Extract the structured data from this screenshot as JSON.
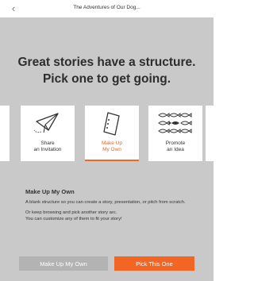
{
  "topbar": {
    "back_icon": "chevron-left-icon",
    "document_title": "The Adventures of Our Dog..."
  },
  "headline": {
    "line1": "Great stories have a structure.",
    "line2": "Pick one to get going."
  },
  "story_types": [
    {
      "icon": "paper-plane-icon",
      "label_line1": "Share",
      "label_line2": "an Invitation"
    },
    {
      "icon": "blank-page-icon",
      "label_line1": "Make Up",
      "label_line2": "My Own",
      "selected": true
    },
    {
      "icon": "fish-school-icon",
      "label_line1": "Promote",
      "label_line2": "an Idea"
    }
  ],
  "colors": {
    "accent": "#f26522",
    "background": "#c9c9c9",
    "secondary_button": "#b3b3b3"
  },
  "description": {
    "title": "Make Up My Own",
    "paragraph1": "A blank structure so you can create a story, presentation, or pitch from scratch.",
    "paragraph2_line1": "Or keep browsing and pick another story arc.",
    "paragraph2_line2": "You can customize any of them to fit your story!"
  },
  "buttons": {
    "secondary_label": "Make Up My Own",
    "primary_label": "Pick This One"
  }
}
